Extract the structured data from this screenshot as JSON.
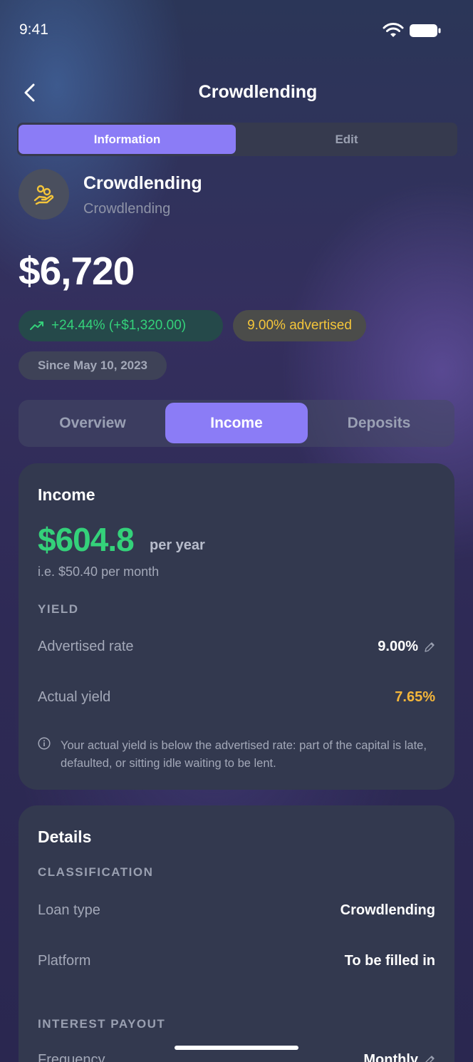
{
  "status": {
    "time": "9:41"
  },
  "header": {
    "title": "Crowdlending",
    "back_icon": "chevron-left-icon"
  },
  "segmented": {
    "information": "Information",
    "edit": "Edit"
  },
  "asset": {
    "name": "Crowdlending",
    "category": "Crowdlending",
    "icon": "hand-coins-icon",
    "amount": "$6,720",
    "gain": "+24.44% (+$1,320.00)",
    "advertised": "9.00% advertised",
    "since": "Since May 10, 2023"
  },
  "tabs": {
    "overview": "Overview",
    "income": "Income",
    "deposits": "Deposits"
  },
  "income_card": {
    "title": "Income",
    "value": "$604.8",
    "per_year": "per year",
    "per_month": "i.e. $50.40 per month",
    "yield_label": "YIELD",
    "advertised_rate_label": "Advertised rate",
    "advertised_rate_value": "9.00%",
    "actual_yield_label": "Actual yield",
    "actual_yield_value": "7.65%",
    "note": "Your actual yield is below the advertised rate: part of the capital is late, defaulted, or sitting idle waiting to be lent."
  },
  "details_card": {
    "title": "Details",
    "classification_label": "CLASSIFICATION",
    "loan_type_label": "Loan type",
    "loan_type_value": "Crowdlending",
    "platform_label": "Platform",
    "platform_value": "To be filled in",
    "interest_payout_label": "INTEREST PAYOUT",
    "frequency_label": "Frequency",
    "frequency_value": "Monthly"
  },
  "colors": {
    "accent": "#8b7cf6",
    "positive": "#34d17a",
    "warning": "#f4b63a",
    "card": "#33394f"
  }
}
